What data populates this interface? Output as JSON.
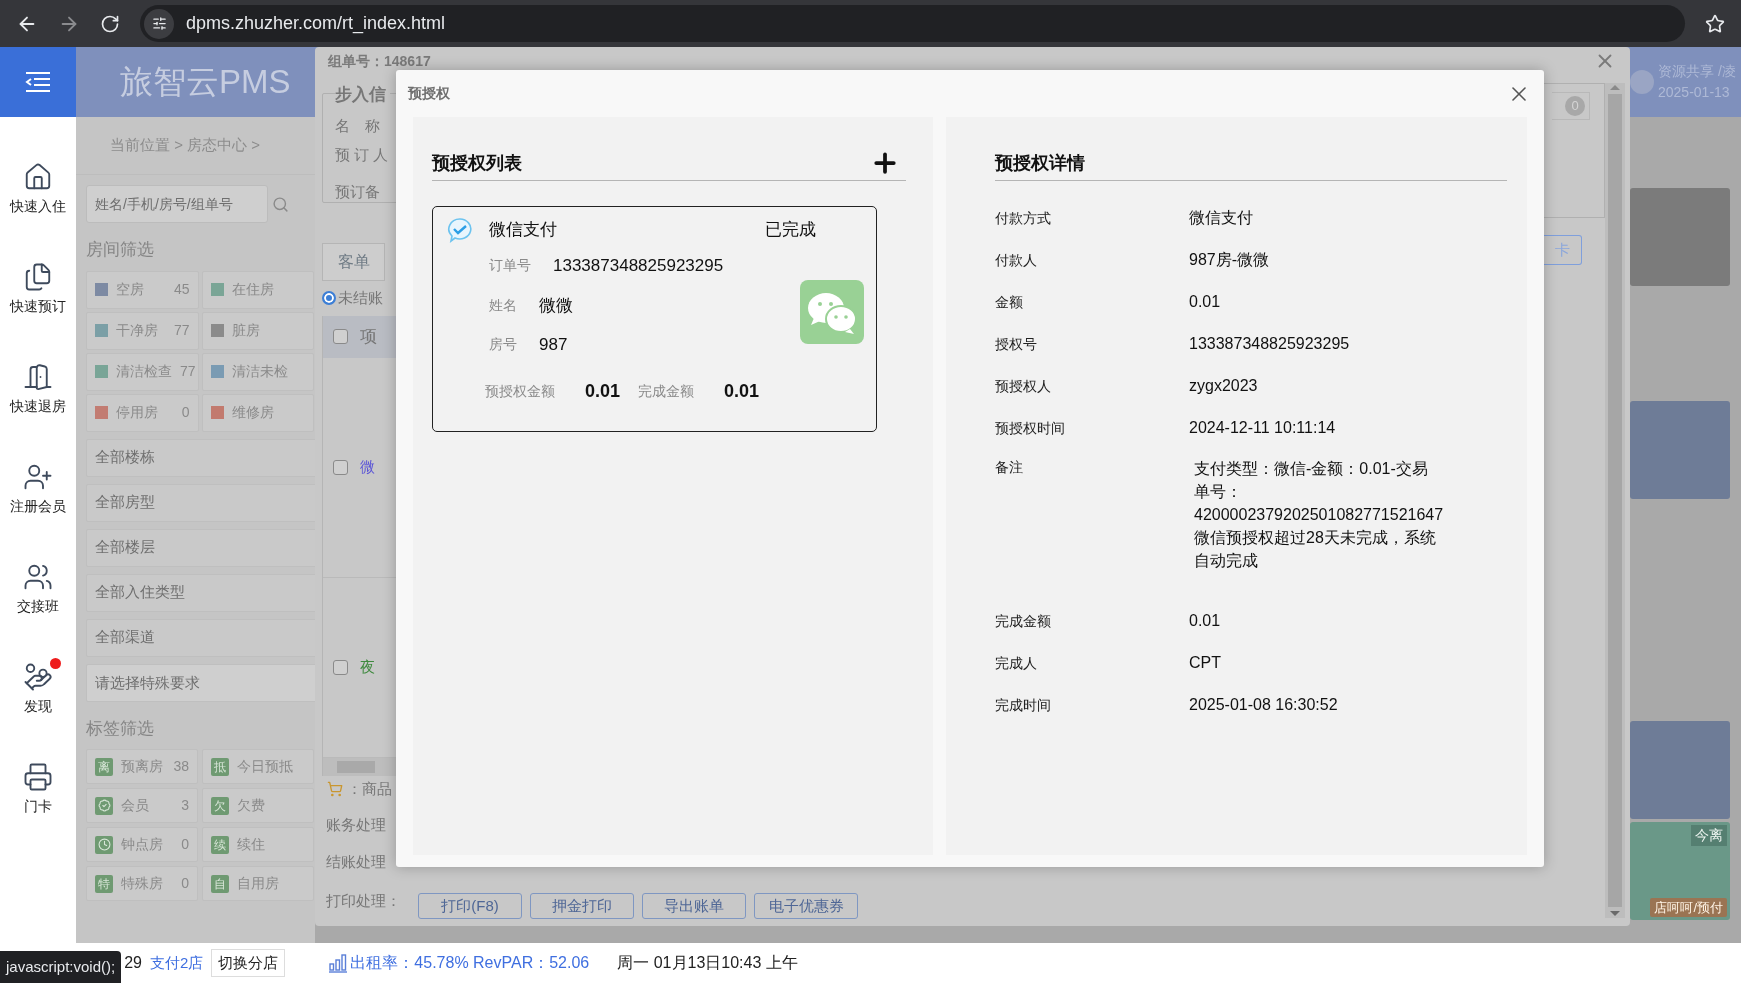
{
  "browser": {
    "url": "dpms.zhuzher.com/rt_index.html"
  },
  "app": {
    "logo": "旅智云PMS",
    "user": "资源共享 /凌",
    "date": "2025-01-13"
  },
  "sidebar": {
    "items": [
      {
        "label": "快速入住",
        "notification": false
      },
      {
        "label": "快速预订",
        "notification": false
      },
      {
        "label": "快速退房",
        "notification": false
      },
      {
        "label": "注册会员",
        "notification": false
      },
      {
        "label": "交接班",
        "notification": false
      },
      {
        "label": "发现",
        "notification": true
      },
      {
        "label": "门卡",
        "notification": false
      }
    ]
  },
  "breadcrumb": "当前位置 > 房态中心 >",
  "search": {
    "placeholder": "姓名/手机/房号/组单号"
  },
  "room_filter": {
    "title": "房间筛选",
    "items": [
      {
        "label": "空房",
        "count": "45",
        "color": "#7d8aa3"
      },
      {
        "label": "在住房",
        "color": "#7aa596"
      },
      {
        "label": "干净房",
        "count": "77",
        "color": "#7b9fa6"
      },
      {
        "label": "脏房",
        "color": "#8b8b8b"
      },
      {
        "label": "清洁检查",
        "count": "77",
        "color": "#79a597"
      },
      {
        "label": "清洁未检",
        "color": "#7a9bb3"
      },
      {
        "label": "停用房",
        "count": "0",
        "color": "#c27c72"
      },
      {
        "label": "维修房",
        "color": "#c27a6e"
      }
    ]
  },
  "dropdowns": [
    "全部楼栋",
    "全部房型",
    "全部楼层",
    "全部入住类型",
    "全部渠道"
  ],
  "special": {
    "placeholder": "请选择特殊要求"
  },
  "tag_filter": {
    "title": "标签筛选",
    "items": [
      {
        "kind": "glyph",
        "glyph": "离",
        "label": "预离房",
        "count": "38"
      },
      {
        "kind": "glyph",
        "glyph": "抵",
        "label": "今日预抵"
      },
      {
        "kind": "member",
        "label": "会员",
        "count": "3"
      },
      {
        "kind": "glyph",
        "glyph": "欠",
        "label": "欠费"
      },
      {
        "kind": "clock",
        "label": "钟点房",
        "count": "0"
      },
      {
        "kind": "glyph",
        "glyph": "续",
        "label": "续住"
      },
      {
        "kind": "glyph",
        "glyph": "特",
        "label": "特殊房",
        "count": "0"
      },
      {
        "kind": "glyph",
        "glyph": "自",
        "label": "自用房"
      }
    ]
  },
  "tiles": [
    {
      "color": "#7b7b7b"
    },
    {
      "color": "#6e7c97"
    },
    {
      "color": "#6e7c97"
    },
    {
      "color": "#6a9888",
      "badge": "今离",
      "tag": "店呵呵/预付"
    }
  ],
  "back_modal": {
    "order_no": "组单号：148617",
    "legend": "步入信",
    "fields": [
      "名　称",
      "预 订 人",
      "预订备"
    ],
    "tab": "客单",
    "radio": {
      "label": "未结账",
      "selected": true
    },
    "table": {
      "header": {
        "text": "项",
        "checked": false
      },
      "rows": [
        {
          "text": "微",
          "color": "#5b55d6",
          "checked": false
        },
        {
          "text": "夜",
          "color": "#3f8a3f",
          "checked": false
        }
      ]
    },
    "goods": "：商品",
    "actions": [
      "账务处理",
      "结账处理"
    ],
    "print": {
      "label": "打印处理：",
      "buttons": [
        "打印(F8)",
        "押金打印",
        "导出账单",
        "电子优惠券"
      ]
    },
    "badge": "0",
    "side_button": "卡"
  },
  "modal": {
    "title": "预授权",
    "list": {
      "title": "预授权列表",
      "cards": [
        {
          "method": "微信支付",
          "status": "已完成",
          "fields": [
            {
              "label": "订单号",
              "value": "133387348825923295"
            },
            {
              "label": "姓名",
              "value": "微微"
            },
            {
              "label": "房号",
              "value": "987"
            }
          ],
          "amounts": [
            {
              "label": "预授权金额",
              "value": "0.01"
            },
            {
              "label": "完成金额",
              "value": "0.01"
            }
          ]
        }
      ]
    },
    "detail": {
      "title": "预授权详情",
      "rows": [
        {
          "label": "付款方式",
          "value": "微信支付"
        },
        {
          "label": "付款人",
          "value": "987房-微微"
        },
        {
          "label": "金额",
          "value": "0.01"
        },
        {
          "label": "授权号",
          "value": "133387348825923295"
        },
        {
          "label": "预授权人",
          "value": "zygx2023"
        },
        {
          "label": "预授权时间",
          "value": "2024-12-11 10:11:14"
        },
        {
          "label": "备注",
          "value": "支付类型：微信-金额：0.01-交易单号：4200002379202501082771521647微信预授权超过28天未完成，系统自动完成"
        },
        {
          "label": "完成金额",
          "value": "0.01"
        },
        {
          "label": "完成人",
          "value": "CPT"
        },
        {
          "label": "完成时间",
          "value": "2025-01-08 16:30:52"
        }
      ]
    }
  },
  "status_bar": {
    "link_hint": "javascript:void();",
    "count": "29",
    "store": "支付2店",
    "switch": "切换分店",
    "stats": "出租率：45.78% RevPAR：52.06",
    "datetime": "周一 01月13日10:43 上午"
  }
}
